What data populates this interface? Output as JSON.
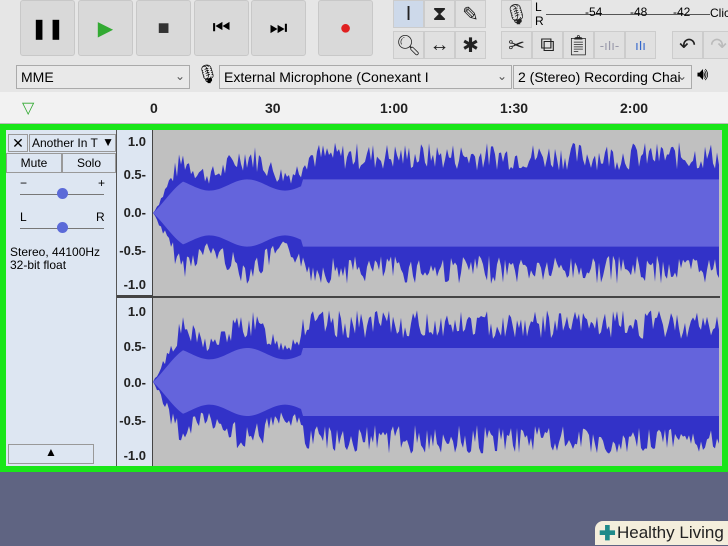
{
  "transport": {
    "buttons": [
      "pause",
      "play",
      "stop",
      "skip-start",
      "skip-end",
      "record"
    ]
  },
  "meter": {
    "channels": [
      "L",
      "R"
    ],
    "ticks": [
      "-54",
      "-48",
      "-42"
    ],
    "hint": "Clic"
  },
  "device": {
    "host": "MME",
    "input": "External Microphone (Conexant I",
    "channels": "2 (Stereo) Recording Chai"
  },
  "ruler": {
    "labels": [
      "0",
      "30",
      "1:00",
      "1:30",
      "2:00"
    ]
  },
  "track": {
    "name": "Another In T",
    "mute": "Mute",
    "solo": "Solo",
    "gain_minus": "−",
    "gain_plus": "+",
    "pan_left": "L",
    "pan_right": "R",
    "info1": "Stereo, 44100Hz",
    "info2": "32-bit float",
    "gain": 0.5,
    "pan": 0.5
  },
  "scale": [
    "1.0",
    "0.5-",
    "0.0-",
    "-0.5-",
    "-1.0"
  ],
  "colors": {
    "wave": "#3232c8",
    "rms": "#6464dc",
    "selection": "#19e619"
  },
  "watermark": "Healthy Living"
}
